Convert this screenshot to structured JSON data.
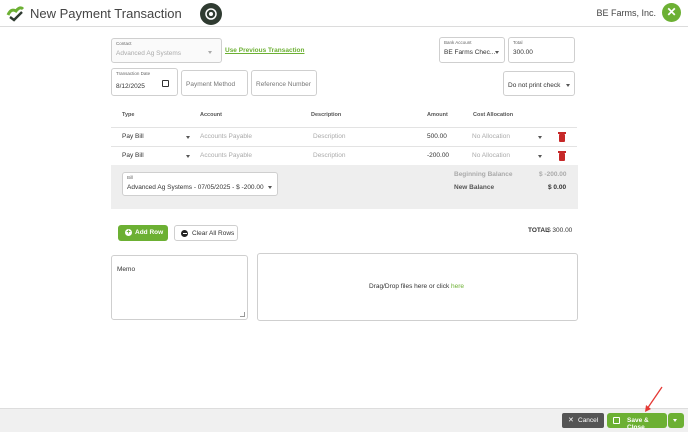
{
  "header": {
    "title": "New Payment Transaction",
    "company": "BE Farms, Inc.",
    "close_symbol": "✕"
  },
  "form": {
    "contact": {
      "label": "Contact",
      "value": "Advanced Ag Systems"
    },
    "use_previous_link": "Use Previous Transaction",
    "bank_account": {
      "label": "Bank Account",
      "value": "BE Farms Chec..."
    },
    "total": {
      "label": "Total",
      "value": "300.00"
    },
    "transaction_date": {
      "label": "Transaction Date",
      "value": "8/12/2025"
    },
    "payment_method": {
      "placeholder": "Payment Method"
    },
    "reference_number": {
      "placeholder": "Reference Number"
    },
    "print_check": {
      "value": "Do not print check"
    }
  },
  "table": {
    "headers": {
      "type": "Type",
      "account": "Account",
      "description": "Description",
      "amount": "Amount",
      "cost_allocation": "Cost Allocation"
    },
    "rows": [
      {
        "type": "Pay Bill",
        "account": "Accounts Payable",
        "description": "Description",
        "amount": "500.00",
        "cost_allocation": "No Allocation"
      },
      {
        "type": "Pay Bill",
        "account": "Accounts Payable",
        "description": "Description",
        "amount": "-200.00",
        "cost_allocation": "No Allocation"
      }
    ]
  },
  "bill_panel": {
    "bill_label": "Bill",
    "bill_value": "Advanced Ag Systems - 07/05/2025 - $ -200.00",
    "beginning_balance_label": "Beginning Balance",
    "beginning_balance_value": "$ -200.00",
    "new_balance_label": "New Balance",
    "new_balance_value": "$ 0.00"
  },
  "actions": {
    "add_row": "Add Row",
    "clear_all_rows": "Clear All Rows",
    "total_label": "TOTAL",
    "total_value": "$ 300.00"
  },
  "memo": {
    "label": "Memo"
  },
  "dropzone": {
    "text": "Drag/Drop files here or click ",
    "link": "here"
  },
  "footer": {
    "cancel": "Cancel",
    "save_close": "Save & Close"
  },
  "colors": {
    "accent_green": "#6cb033",
    "trash_red": "#c62828",
    "dark_button": "#555555"
  },
  "icons": [
    "logo-icon",
    "settings-wheel-icon",
    "close-icon",
    "calendar-icon",
    "trash-icon",
    "plus-circle-icon",
    "minus-circle-icon",
    "save-icon",
    "arrow-annotation-icon"
  ]
}
